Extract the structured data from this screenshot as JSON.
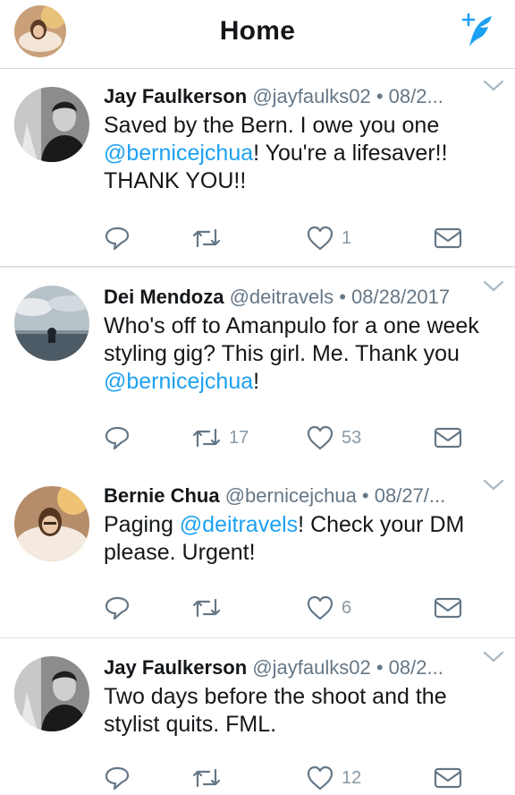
{
  "header": {
    "title": "Home",
    "profile_icon": "user-avatar",
    "compose_icon": "compose-tweet-icon",
    "accent_color": "#1da1f2"
  },
  "tweets": [
    {
      "name": "Jay Faulkerson",
      "handle": "@jayfaulks02",
      "separator": " • ",
      "date": "08/2...",
      "text_parts": [
        {
          "text": "Saved by the Bern. I owe you one "
        },
        {
          "text": "@bernicejchua",
          "mention": true
        },
        {
          "text": "! You're a lifesaver!! THANK YOU!!"
        }
      ],
      "retweets": "",
      "likes": "1"
    },
    {
      "name": "Dei Mendoza",
      "handle": "@deitravels",
      "separator": " • ",
      "date": "08/28/2017",
      "text_parts": [
        {
          "text": "Who's off to Amanpulo for a one week styling gig? This girl. Me. Thank you "
        },
        {
          "text": "@bernicejchua",
          "mention": true
        },
        {
          "text": "!"
        }
      ],
      "retweets": "17",
      "likes": "53"
    },
    {
      "name": "Bernie Chua",
      "handle": "@bernicejchua",
      "separator": " • ",
      "date": "08/27/...",
      "text_parts": [
        {
          "text": "Paging "
        },
        {
          "text": "@deitravels",
          "mention": true
        },
        {
          "text": "! Check your DM please. Urgent!"
        }
      ],
      "retweets": "",
      "likes": "6"
    },
    {
      "name": "Jay Faulkerson",
      "handle": "@jayfaulks02",
      "separator": " • ",
      "date": "08/2...",
      "text_parts": [
        {
          "text": "Two days before the shoot and the stylist quits. FML."
        }
      ],
      "retweets": "",
      "likes": "12"
    }
  ],
  "icons": [
    "reply-icon",
    "retweet-icon",
    "like-icon",
    "direct-message-icon",
    "chevron-down-icon"
  ]
}
